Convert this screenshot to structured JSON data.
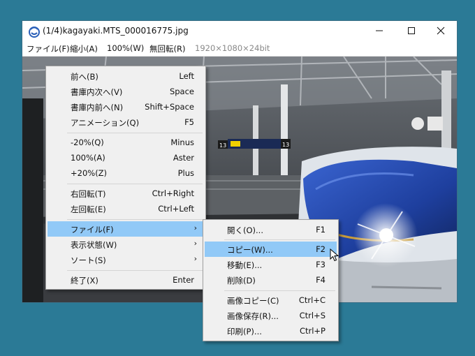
{
  "window": {
    "title": "(1/4)kagayaki.MTS_000016775.jpg",
    "controls": {
      "minimize": "—",
      "maximize": "☐",
      "close": "✕"
    }
  },
  "menubar": {
    "items": [
      "ファイル(F)",
      "縮小(A)",
      "100%(W)",
      "無回転(R)"
    ],
    "info": "1920×1080×24bit"
  },
  "context_menu": {
    "items": [
      {
        "label": "前へ(B)",
        "key": "Left"
      },
      {
        "label": "書庫内次へ(V)",
        "key": "Space"
      },
      {
        "label": "書庫内前へ(N)",
        "key": "Shift+Space"
      },
      {
        "label": "アニメーション(Q)",
        "key": "F5"
      },
      {
        "label": "-20%(Q)",
        "key": "Minus"
      },
      {
        "label": "100%(A)",
        "key": "Aster"
      },
      {
        "label": "+20%(Z)",
        "key": "Plus"
      },
      {
        "label": "右回転(T)",
        "key": "Ctrl+Right"
      },
      {
        "label": "左回転(E)",
        "key": "Ctrl+Left"
      },
      {
        "label": "ファイル(F)",
        "arrow": "›"
      },
      {
        "label": "表示状態(W)",
        "arrow": "›"
      },
      {
        "label": "ソート(S)",
        "arrow": "›"
      },
      {
        "label": "終了(X)",
        "key": "Enter"
      }
    ]
  },
  "file_submenu": {
    "items": [
      {
        "label": "開く(O)...",
        "key": "F1"
      },
      {
        "label": "コピー(W)...",
        "key": "F2"
      },
      {
        "label": "移動(E)...",
        "key": "F3"
      },
      {
        "label": "削除(D)",
        "key": "F4"
      },
      {
        "label": "画像コピー(C)",
        "key": "Ctrl+C"
      },
      {
        "label": "画像保存(R)...",
        "key": "Ctrl+S"
      },
      {
        "label": "印刷(P)...",
        "key": "Ctrl+P"
      }
    ]
  },
  "photo": {
    "platform_number_left": "13",
    "platform_number_right": "13"
  },
  "colors": {
    "desktop": "#2b7a96",
    "highlight": "#91c9f7",
    "train_blue": "#1e3f9e",
    "train_white": "#dfe4ea"
  }
}
